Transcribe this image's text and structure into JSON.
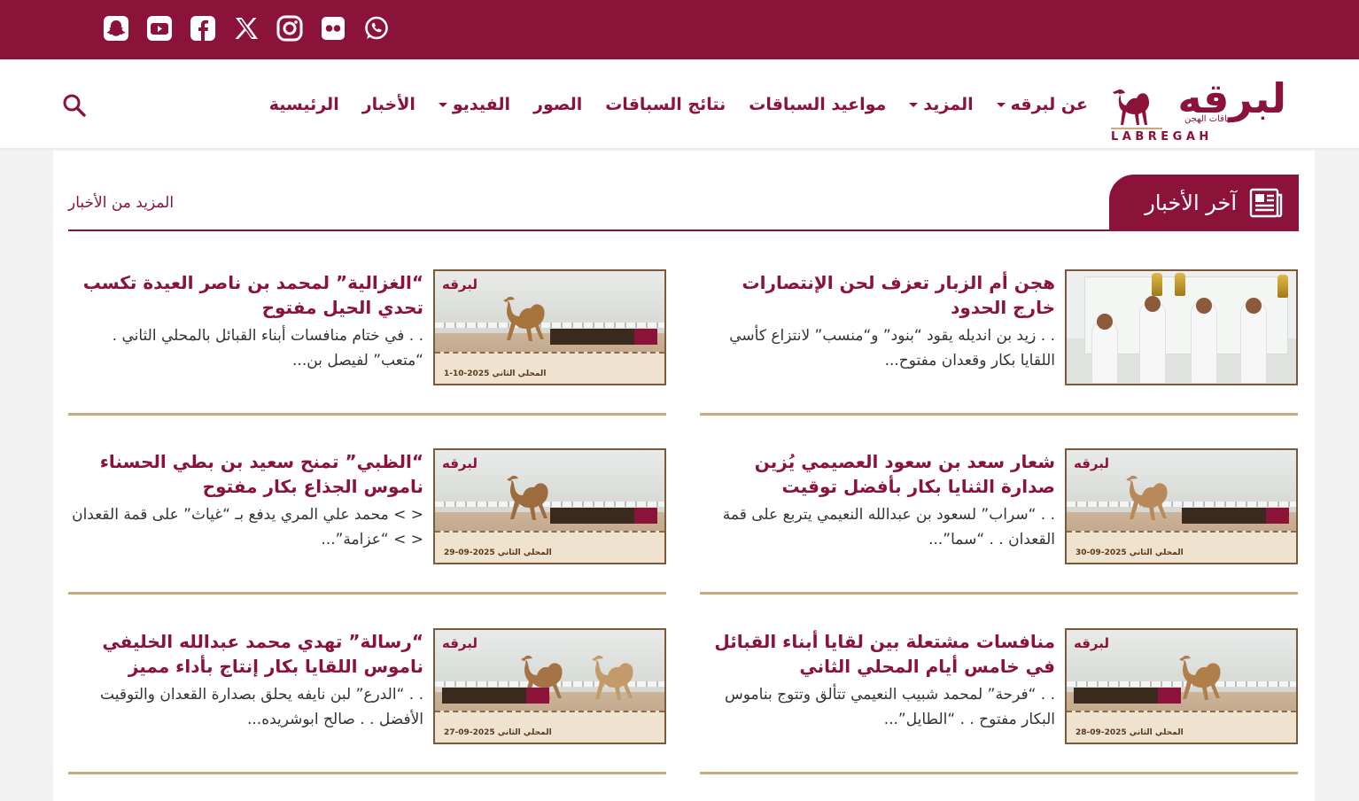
{
  "social": [
    "whatsapp-icon",
    "flickr-icon",
    "instagram-icon",
    "x-icon",
    "facebook-icon",
    "youtube-icon",
    "snapchat-icon"
  ],
  "logo": {
    "arabic": "لبرقه",
    "subtitle": "لسباقات الهجن",
    "english": "LABREGAH"
  },
  "nav": [
    {
      "label": "الرئيسية",
      "dropdown": false
    },
    {
      "label": "الأخبار",
      "dropdown": false
    },
    {
      "label": "الفيديو",
      "dropdown": true
    },
    {
      "label": "الصور",
      "dropdown": false
    },
    {
      "label": "نتائج السباقات",
      "dropdown": false
    },
    {
      "label": "مواعيد السباقات",
      "dropdown": false
    },
    {
      "label": "المزيد",
      "dropdown": true
    },
    {
      "label": "عن لبرقه",
      "dropdown": true
    }
  ],
  "section": {
    "title": "آخر الأخبار",
    "more": "المزيد من الأخبار"
  },
  "articles": [
    {
      "title": "هجن أم الزبار تعزف لحن الإنتصارات خارج الحدود",
      "excerpt": ". . زيد بن انديله يقود “بنود” و“منسب” لانتزاع كأسي اللقايا بكار وقعدان مفتوح..."
    },
    {
      "title": "“الغزالية” لمحمد بن ناصر العيدة تكسب تحدي الحيل مفتوح",
      "excerpt": ". . في ختام منافسات أبناء القبائل بالمحلي الثاني . “متعب” لفيصل بن..."
    },
    {
      "title": "شعار سعد بن سعود العصيمي يُزين صدارة الثنايا بكار بأفضل توقيت",
      "excerpt": ". . “سراب” لسعود بن عبدالله النعيمي يتربع على قمة القعدان . . “سما”..."
    },
    {
      "title": "“الظبي” تمنح سعيد بن بطي الحسناء ناموس الجذاع بكار مفتوح",
      "excerpt": "< > محمد علي المري يدفع بـ “غياث” على قمة القعدان < > “عزامة”..."
    },
    {
      "title": "منافسات مشتعلة بين لقايا أبناء القبائل في خامس أيام المحلي الثاني",
      "excerpt": ". . “فرحة” لمحمد شبيب النعيمي تتألق وتتوج بناموس البكار مفتوح . . “الطايل”..."
    },
    {
      "title": "“رسالة” تهدي محمد عبدالله الخليفي ناموس اللقايا بكار إنتاج بأداء مميز",
      "excerpt": ". . “الدرع” لبن نايفه يحلق بصدارة القعدان والتوقيت الأفضل . . صالح ابوشريده..."
    }
  ],
  "thumbs": [
    {
      "brand": "لبرقه",
      "label": "المحلي الثاني",
      "date": "2025-10-1"
    },
    {
      "brand": "لبرقه",
      "label": "المحلي الثاني",
      "date": "2025-09-30"
    },
    {
      "brand": "لبرقه",
      "label": "المحلي الثاني",
      "date": "2025-09-29"
    },
    {
      "brand": "لبرقه",
      "label": "المحلي الثاني",
      "date": "2025-09-28"
    },
    {
      "brand": "لبرقه",
      "label": "المحلي الثاني",
      "date": "2025-09-27"
    }
  ],
  "colors": {
    "brand": "#8b1238",
    "divider": "#c9a97e",
    "background": "#f2f2f2"
  }
}
